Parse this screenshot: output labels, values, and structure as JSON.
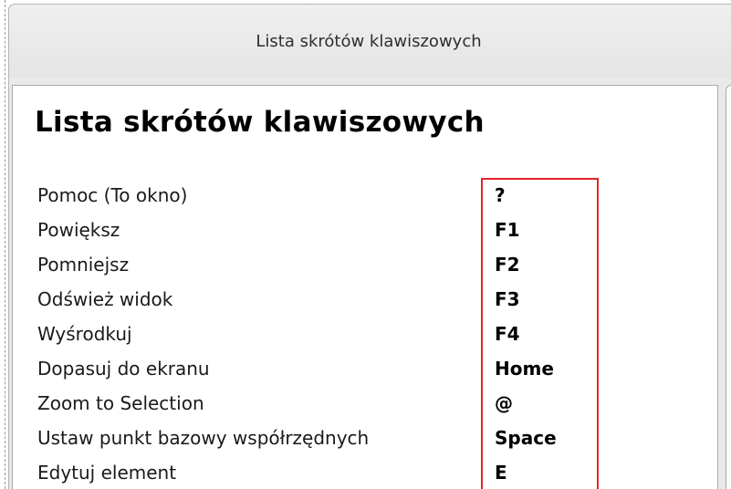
{
  "window": {
    "title": "Lista skrótów klawiszowych"
  },
  "content": {
    "heading": "Lista skrótów klawiszowych",
    "shortcuts": [
      {
        "action": "Pomoc (To okno)",
        "key": "?"
      },
      {
        "action": "Powiększ",
        "key": "F1"
      },
      {
        "action": "Pomniejsz",
        "key": "F2"
      },
      {
        "action": "Odśwież widok",
        "key": "F3"
      },
      {
        "action": "Wyśrodkuj",
        "key": "F4"
      },
      {
        "action": "Dopasuj do ekranu",
        "key": "Home"
      },
      {
        "action": "Zoom to Selection",
        "key": "@"
      },
      {
        "action": "Ustaw punkt bazowy współrzędnych",
        "key": "Space"
      },
      {
        "action": "Edytuj element",
        "key": "E"
      }
    ]
  },
  "colors": {
    "highlight": "#e4242c",
    "titlebar": "#e9e9e9"
  }
}
